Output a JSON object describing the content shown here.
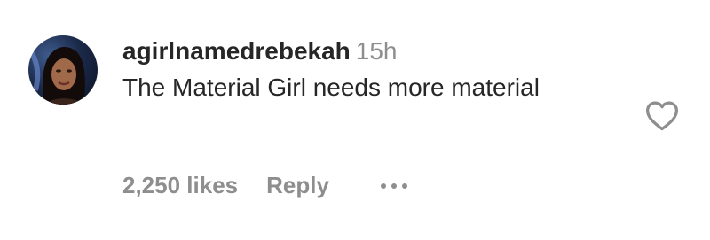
{
  "comment": {
    "username": "agirlnamedrebekah",
    "timestamp": "15h",
    "text": "The Material Girl needs more material",
    "likes": "2,250 likes",
    "reply_label": "Reply",
    "more_icon": "more-horizontal-icon",
    "like_icon": "heart-outline-icon",
    "avatar": "user-avatar"
  },
  "colors": {
    "primary_text": "#262626",
    "secondary_text": "#8e8e8e",
    "heart_stroke": "#8e8e8e"
  }
}
